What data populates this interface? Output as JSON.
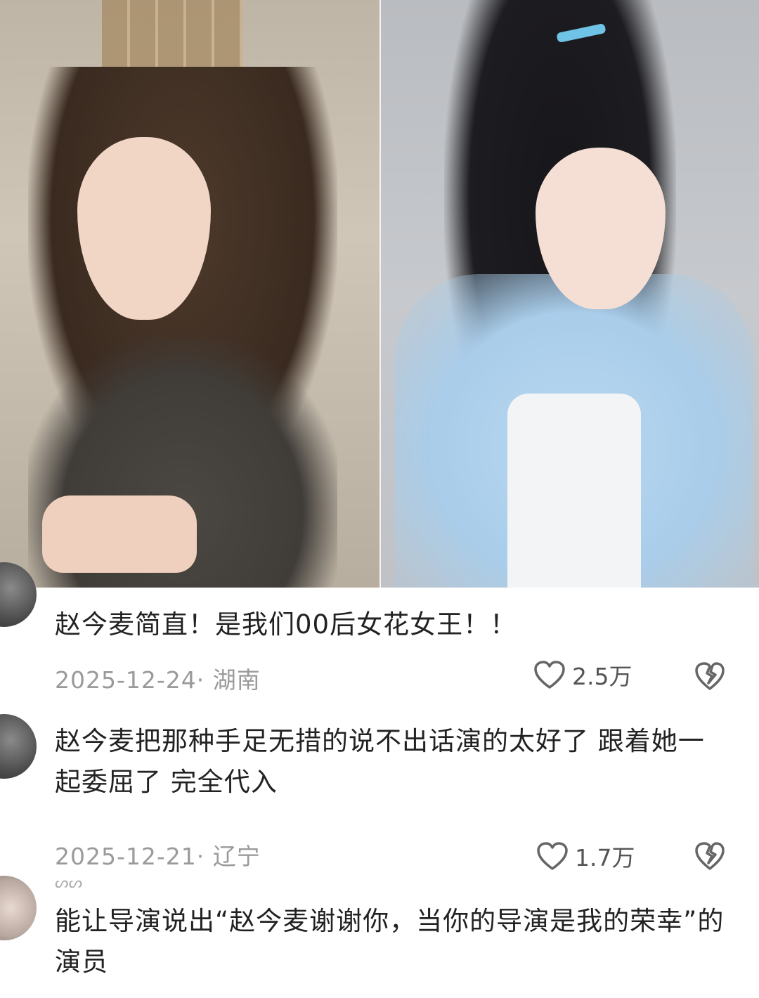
{
  "comments": [
    {
      "text": "赵今麦简直！是我们00后女花女王！！",
      "date": "2025-12-24",
      "location": "湖南",
      "likes": "2.5万"
    },
    {
      "text": "赵今麦把那种手足无措的说不出话演的太好了  跟着她一起委屈了  完全代入",
      "date": "2025-12-21",
      "location": "辽宁",
      "likes": "1.7万"
    },
    {
      "handle": "ᔕᔕ",
      "text": "能让导演说出“赵今麦谢谢你，当你的导演是我的荣幸”的演员"
    }
  ],
  "icons": {
    "like": "heart-outline-icon",
    "dislike": "broken-heart-icon"
  },
  "colors": {
    "text": "#222222",
    "meta": "#9a9a9a",
    "like": "#555555"
  }
}
